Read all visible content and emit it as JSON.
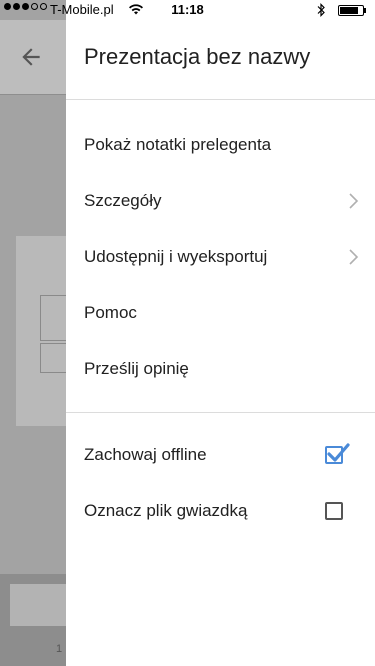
{
  "status_bar": {
    "carrier": "T-Mobile.pl",
    "time": "11:18",
    "signal_bars": 3,
    "battery_level_pct": 80
  },
  "drawer": {
    "title": "Prezentacja bez nazwy",
    "menu_items": [
      {
        "label": "Pokaż notatki prelegenta"
      },
      {
        "label": "Szczegóły",
        "icon": "chevron-right-icon"
      },
      {
        "label": "Udostępnij i wyeksportuj",
        "icon": "chevron-right-icon"
      },
      {
        "label": "Pomoc"
      },
      {
        "label": "Prześlij opinię"
      }
    ],
    "toggles": [
      {
        "label": "Zachowaj offline",
        "checked": true
      },
      {
        "label": "Oznacz plik gwiazdką",
        "checked": false
      }
    ]
  },
  "background": {
    "page_number": "1"
  },
  "colors": {
    "accent": "#4a8ad8",
    "overlay": "#a3a3a3"
  }
}
